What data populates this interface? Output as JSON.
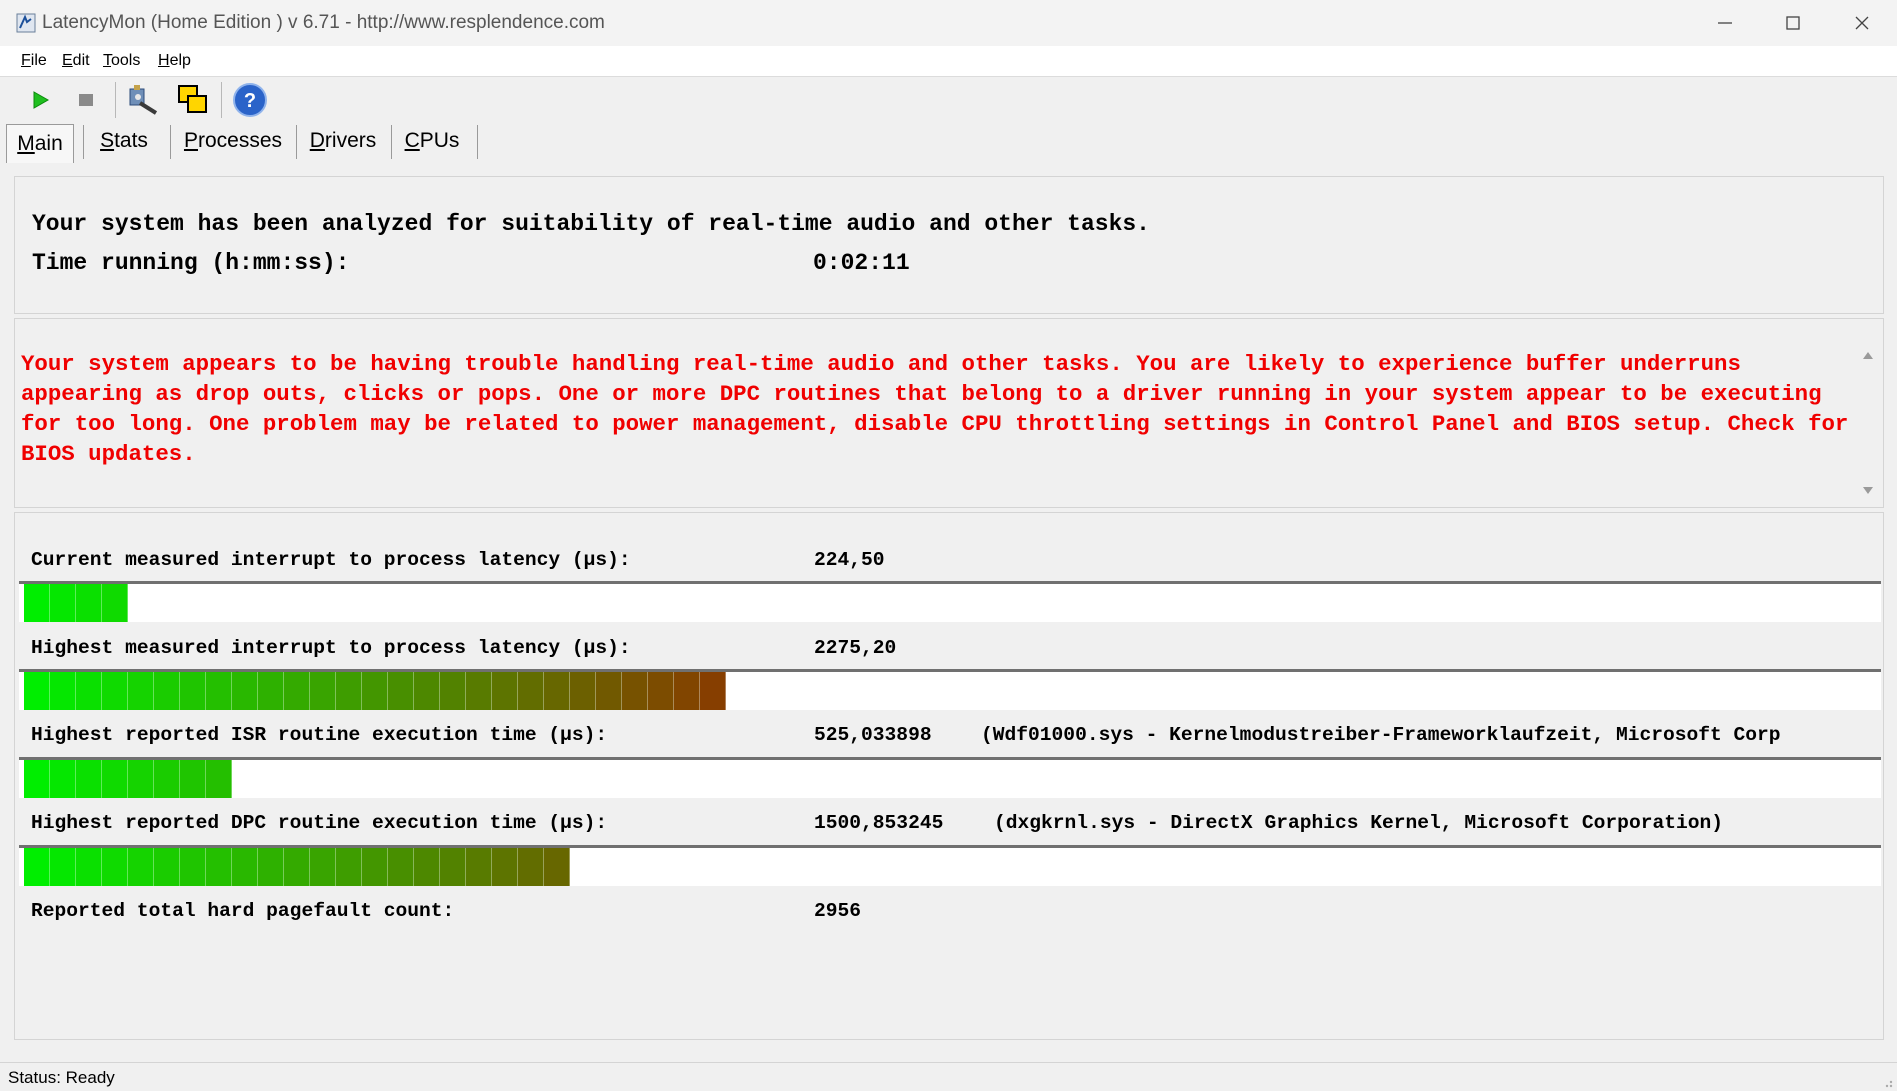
{
  "window": {
    "title": "LatencyMon  (Home Edition )  v 6.71 - http://www.resplendence.com"
  },
  "menu": {
    "items": [
      {
        "label": "File",
        "accel": "F",
        "rest": "ile"
      },
      {
        "label": "Edit",
        "accel": "E",
        "rest": "dit"
      },
      {
        "label": "Tools",
        "accel": "T",
        "rest": "ools"
      },
      {
        "label": "Help",
        "accel": "H",
        "rest": "elp"
      }
    ]
  },
  "toolbar": {
    "icons": [
      "play-icon",
      "stop-icon",
      "driver-icon",
      "windows-icon",
      "help-icon"
    ]
  },
  "tabs": [
    {
      "label": "Main",
      "accel": "M",
      "rest": "ain",
      "active": true
    },
    {
      "label": "Stats",
      "accel": "S",
      "rest": "tats",
      "active": false
    },
    {
      "label": "Processes",
      "accel": "P",
      "rest": "rocesses",
      "active": false
    },
    {
      "label": "Drivers",
      "accel": "D",
      "rest": "rivers",
      "active": false
    },
    {
      "label": "CPUs",
      "accel": "C",
      "rest": "PUs",
      "active": false
    }
  ],
  "analysis": {
    "headline": "Your system has been analyzed for suitability of real-time audio and other tasks.",
    "time_label": "Time running (h:mm:ss):",
    "time_value": "0:02:11"
  },
  "warning": {
    "text": "Your system appears to be having trouble handling real-time audio and other tasks. You are likely to experience buffer underruns appearing as drop outs, clicks or pops. One or more DPC routines that belong to a driver running in your system appear to be executing for too long. One problem may be related to power management, disable CPU throttling settings in Control Panel and BIOS setup. Check for BIOS updates.",
    "color": "#f00000"
  },
  "metrics": [
    {
      "label": "Current measured interrupt to process latency (µs):",
      "value": "224,50",
      "extra": "",
      "bar_segments": 4
    },
    {
      "label": "Highest measured interrupt to process latency (µs):",
      "value": "2275,20",
      "extra": "",
      "bar_segments": 27
    },
    {
      "label": "Highest reported ISR routine execution time (µs):",
      "value": "525,033898",
      "extra": "(Wdf01000.sys - Kernelmodustreiber-Frameworklaufzeit, Microsoft Corp",
      "bar_segments": 8
    },
    {
      "label": "Highest reported DPC routine execution time (µs):",
      "value": "1500,853245",
      "extra": "(dxgkrnl.sys - DirectX Graphics Kernel, Microsoft Corporation)",
      "bar_segments": 21
    },
    {
      "label": "Reported total hard pagefault count:",
      "value": "2956",
      "extra": ""
    }
  ],
  "status": {
    "text": "Status: Ready"
  }
}
